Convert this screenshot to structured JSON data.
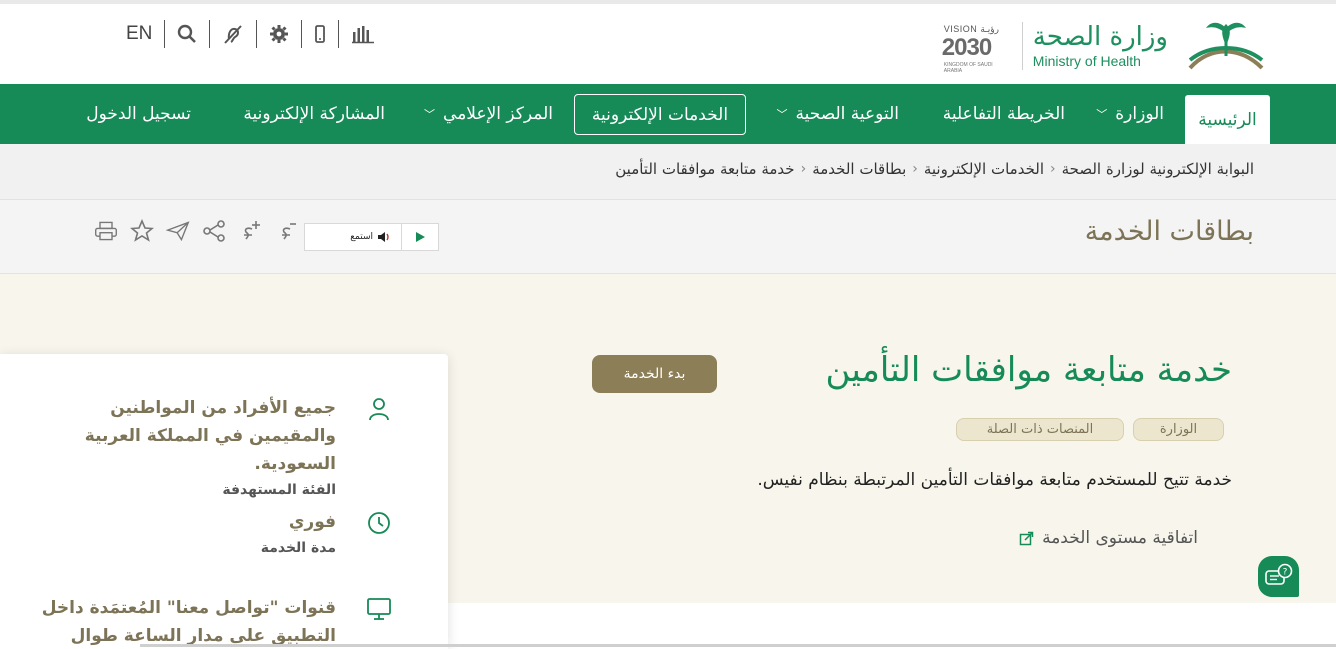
{
  "header": {
    "lang_label": "EN",
    "ministry_ar": "وزارة الصحة",
    "ministry_en": "Ministry of Health",
    "vision_top": "VISION رؤيـة",
    "vision_year": "2030",
    "vision_bottom": "KINGDOM OF SAUDI ARABIA",
    "tools": [
      "search-icon",
      "hearing-icon",
      "gear-icon",
      "mobile-icon",
      "stats-icon"
    ]
  },
  "nav": {
    "home": "الرئيسية",
    "ministry": "الوزارة",
    "map": "الخريطة التفاعلية",
    "awareness": "التوعية الصحية",
    "eservices": "الخدمات الإلكترونية",
    "media": "المركز الإعلامي",
    "participation": "المشاركة الإلكترونية",
    "login": "تسجيل الدخول"
  },
  "breadcrumb": {
    "items": [
      "البوابة الإلكترونية لوزارة الصحة",
      "الخدمات الإلكترونية",
      "بطاقات الخدمة",
      "خدمة متابعة موافقات التأمين"
    ],
    "separator": "‹"
  },
  "page_title": "بطاقات الخدمة",
  "listen": {
    "label": "استمع"
  },
  "service": {
    "title": "خدمة متابعة موافقات التأمين",
    "start_label": "بدء الخدمة",
    "tags": [
      "الوزارة",
      "المنصات ذات الصلة"
    ],
    "description": "خدمة تتيح للمستخدم متابعة موافقات التأمين المرتبطة بنظام نفيس.",
    "sla_label": "اتفاقية مستوى الخدمة"
  },
  "side_card": {
    "target_value": "جميع الأفراد من المواطنين والمقيمين في المملكة العربية السعودية.",
    "target_label": "الفئة المستهدفة",
    "duration_value": "فوري",
    "duration_label": "مدة الخدمة",
    "channels_value": "قنوات \"تواصل معنا\" المُعتمَدة داخل التطبيق على مدار الساعة طوال أيام"
  },
  "colors": {
    "primary_green": "#168a57",
    "gold": "#8c7e57",
    "content_bg": "#f8f6ec"
  }
}
